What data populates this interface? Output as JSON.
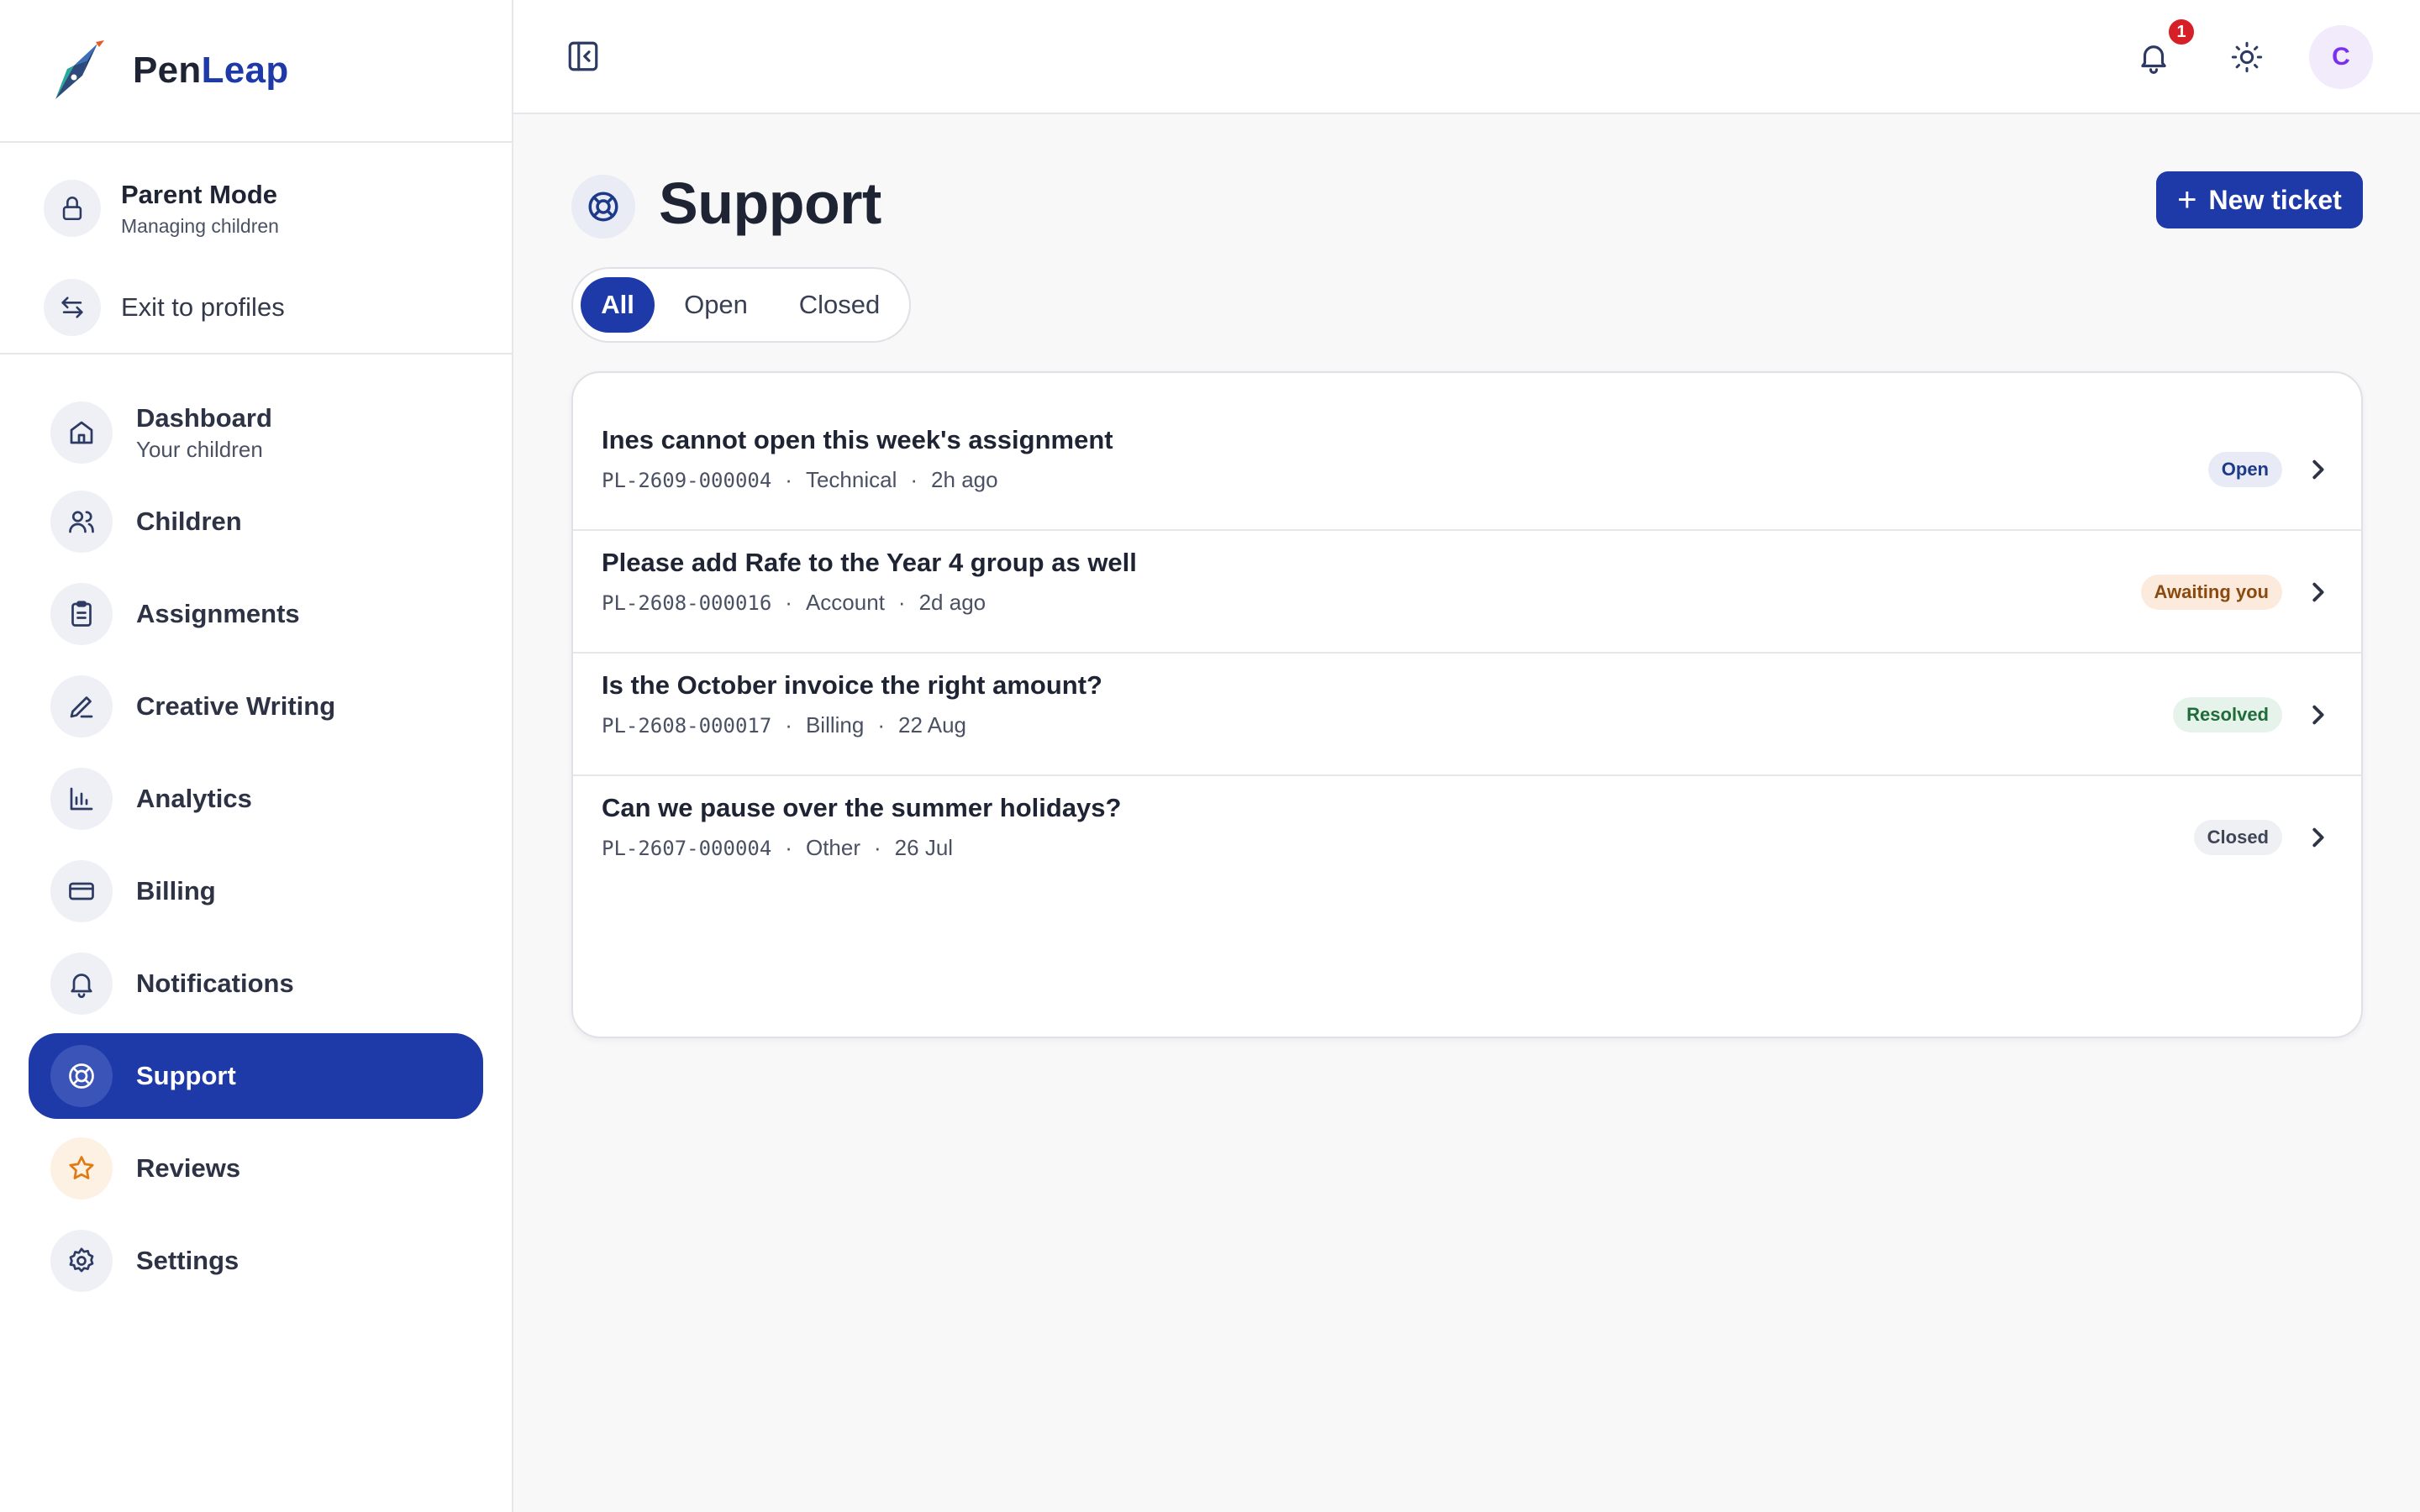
{
  "brand": {
    "name_part1": "Pen",
    "name_part2": "Leap"
  },
  "mode": {
    "title": "Parent Mode",
    "subtitle": "Managing children",
    "exit_label": "Exit to profiles"
  },
  "nav": {
    "dashboard": {
      "label": "Dashboard",
      "sub": "Your children"
    },
    "children": "Children",
    "assignments": "Assignments",
    "creative_writing": "Creative Writing",
    "analytics": "Analytics",
    "billing": "Billing",
    "notifications": "Notifications",
    "support": "Support",
    "reviews": "Reviews",
    "settings": "Settings"
  },
  "topbar": {
    "notification_count": "1",
    "avatar_initial": "C"
  },
  "page": {
    "title": "Support",
    "new_ticket_label": "New ticket",
    "tabs": {
      "all": "All",
      "open": "Open",
      "closed": "Closed"
    }
  },
  "tickets": [
    {
      "title": "Ines cannot open this week's assignment",
      "id": "PL-2609-000004",
      "category": "Technical",
      "time": "2h ago",
      "status": "Open"
    },
    {
      "title": "Please add Rafe to the Year 4 group as well",
      "id": "PL-2608-000016",
      "category": "Account",
      "time": "2d ago",
      "status": "Awaiting you"
    },
    {
      "title": "Is the October invoice the right amount?",
      "id": "PL-2608-000017",
      "category": "Billing",
      "time": "22 Aug",
      "status": "Resolved"
    },
    {
      "title": "Can we pause over the summer holidays?",
      "id": "PL-2607-000004",
      "category": "Other",
      "time": "26 Jul",
      "status": "Closed"
    }
  ],
  "meta_separator": "·",
  "colors": {
    "primary": "#1d3aa8",
    "badge_red": "#d61f26",
    "avatar_text": "#7b2ff0",
    "status_open_bg": "#e8ebf5",
    "status_awaiting_bg": "#fcebdc",
    "status_resolved_bg": "#e5f3ea",
    "status_closed_bg": "#eef0f3"
  },
  "icons": {
    "logo": "pen-nib-logo",
    "parent_mode": "lock-icon",
    "exit": "swap-arrows-icon",
    "dashboard": "home-icon",
    "children": "users-icon",
    "assignments": "clipboard-icon",
    "creative_writing": "pencil-icon",
    "analytics": "bar-chart-icon",
    "billing": "credit-card-icon",
    "notifications": "bell-icon",
    "support": "lifebuoy-icon",
    "reviews": "star-icon",
    "settings": "gear-icon",
    "collapse": "sidebar-collapse-icon",
    "theme": "sun-icon",
    "chevron": "chevron-right-icon"
  }
}
